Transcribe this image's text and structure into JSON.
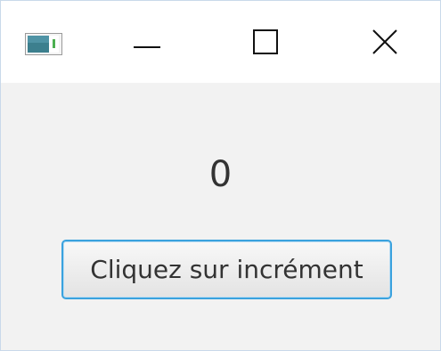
{
  "window": {
    "icons": {
      "app": "app-window-icon",
      "minimize": "minimize-icon",
      "maximize": "maximize-icon",
      "close": "close-icon"
    }
  },
  "main": {
    "counter_value": "0",
    "increment_button_label": "Cliquez sur incrément"
  },
  "colors": {
    "content_background": "#f2f2f2",
    "button_focus_border": "#3aa2de",
    "text": "#333333"
  }
}
